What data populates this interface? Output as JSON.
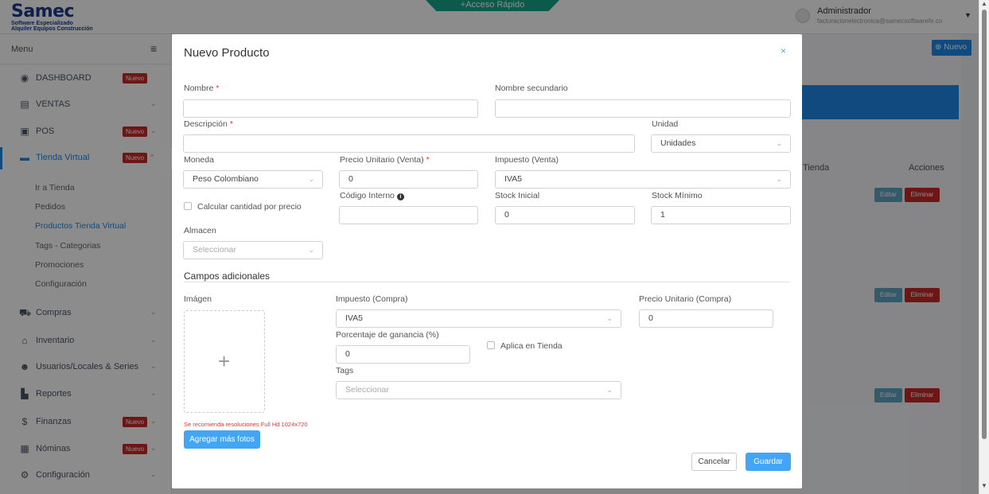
{
  "header": {
    "logo_main": "Samec",
    "logo_sub1": "Software Especializado",
    "logo_sub2": "Alquiler Equipos Construcción",
    "quick_access": "+Acceso Rápido",
    "admin_name": "Administrador",
    "admin_email": "facturacionelectronica@samecsoftwarefe.co"
  },
  "sidebar": {
    "menu_label": "Menu",
    "items": [
      {
        "label": "DASHBOARD",
        "badge": "Nuevo",
        "icon": "palette-icon"
      },
      {
        "label": "VENTAS",
        "icon": "receipt-icon"
      },
      {
        "label": "POS",
        "badge": "Nuevo",
        "icon": "cash-register-icon"
      },
      {
        "label": "Tienda Virtual",
        "badge": "Nuevo",
        "icon": "store-icon"
      },
      {
        "label": "Compras",
        "icon": "cart-icon"
      },
      {
        "label": "Inventario",
        "icon": "warehouse-icon"
      },
      {
        "label": "Usuarios/Locales & Series",
        "icon": "users-icon"
      },
      {
        "label": "Reportes",
        "icon": "chart-icon"
      },
      {
        "label": "Finanzas",
        "badge": "Nuevo",
        "icon": "hand-dollar-icon"
      },
      {
        "label": "Nóminas",
        "badge": "Nuevo",
        "icon": "building-icon"
      },
      {
        "label": "Configuración",
        "icon": "gears-icon"
      }
    ],
    "sub_items": [
      "Ir a Tienda",
      "Pedidos",
      "Productos Tienda Virtual",
      "Tags - Categorias",
      "Promociones",
      "Configuración"
    ]
  },
  "background": {
    "nuevo_btn": "Nuevo",
    "col_tienda": "n Tienda",
    "col_acciones": "Acciones",
    "edit": "Editar",
    "delete": "Eliminar"
  },
  "modal": {
    "title": "Nuevo Producto",
    "close": "×",
    "fields": {
      "nombre_label": "Nombre",
      "nombre_sec_label": "Nombre secundario",
      "descripcion_label": "Descripción",
      "unidad_label": "Unidad",
      "unidad_value": "Unidades",
      "moneda_label": "Moneda",
      "moneda_value": "Peso Colombiano",
      "precio_venta_label": "Precio Unitario (Venta)",
      "precio_venta_value": "0",
      "impuesto_venta_label": "Impuesto (Venta)",
      "impuesto_venta_value": "IVA5",
      "calcular_label": "Calcular cantidad por precio",
      "codigo_label": "Código Interno",
      "stock_inicial_label": "Stock Inicial",
      "stock_inicial_value": "0",
      "stock_minimo_label": "Stock Mínimo",
      "stock_minimo_value": "1",
      "almacen_label": "Almacen",
      "almacen_placeholder": "Seleccionar",
      "campos_adicionales": "Campos adicionales",
      "imagen_label": "Imágen",
      "impuesto_compra_label": "Impuesto (Compra)",
      "impuesto_compra_value": "IVA5",
      "precio_compra_label": "Precio Unitario (Compra)",
      "precio_compra_value": "0",
      "ganancia_label": "Porcentaje de ganancia (%)",
      "ganancia_value": "0",
      "aplica_tienda_label": "Aplica en Tienda",
      "tags_label": "Tags",
      "tags_placeholder": "Seleccionar",
      "img_hint": "Se recomienda resoluciones Full Hd 1024x720"
    },
    "buttons": {
      "add_photos": "Agregar más fotos",
      "cancel": "Cancelar",
      "save": "Guardar"
    },
    "required_mark": "*"
  }
}
